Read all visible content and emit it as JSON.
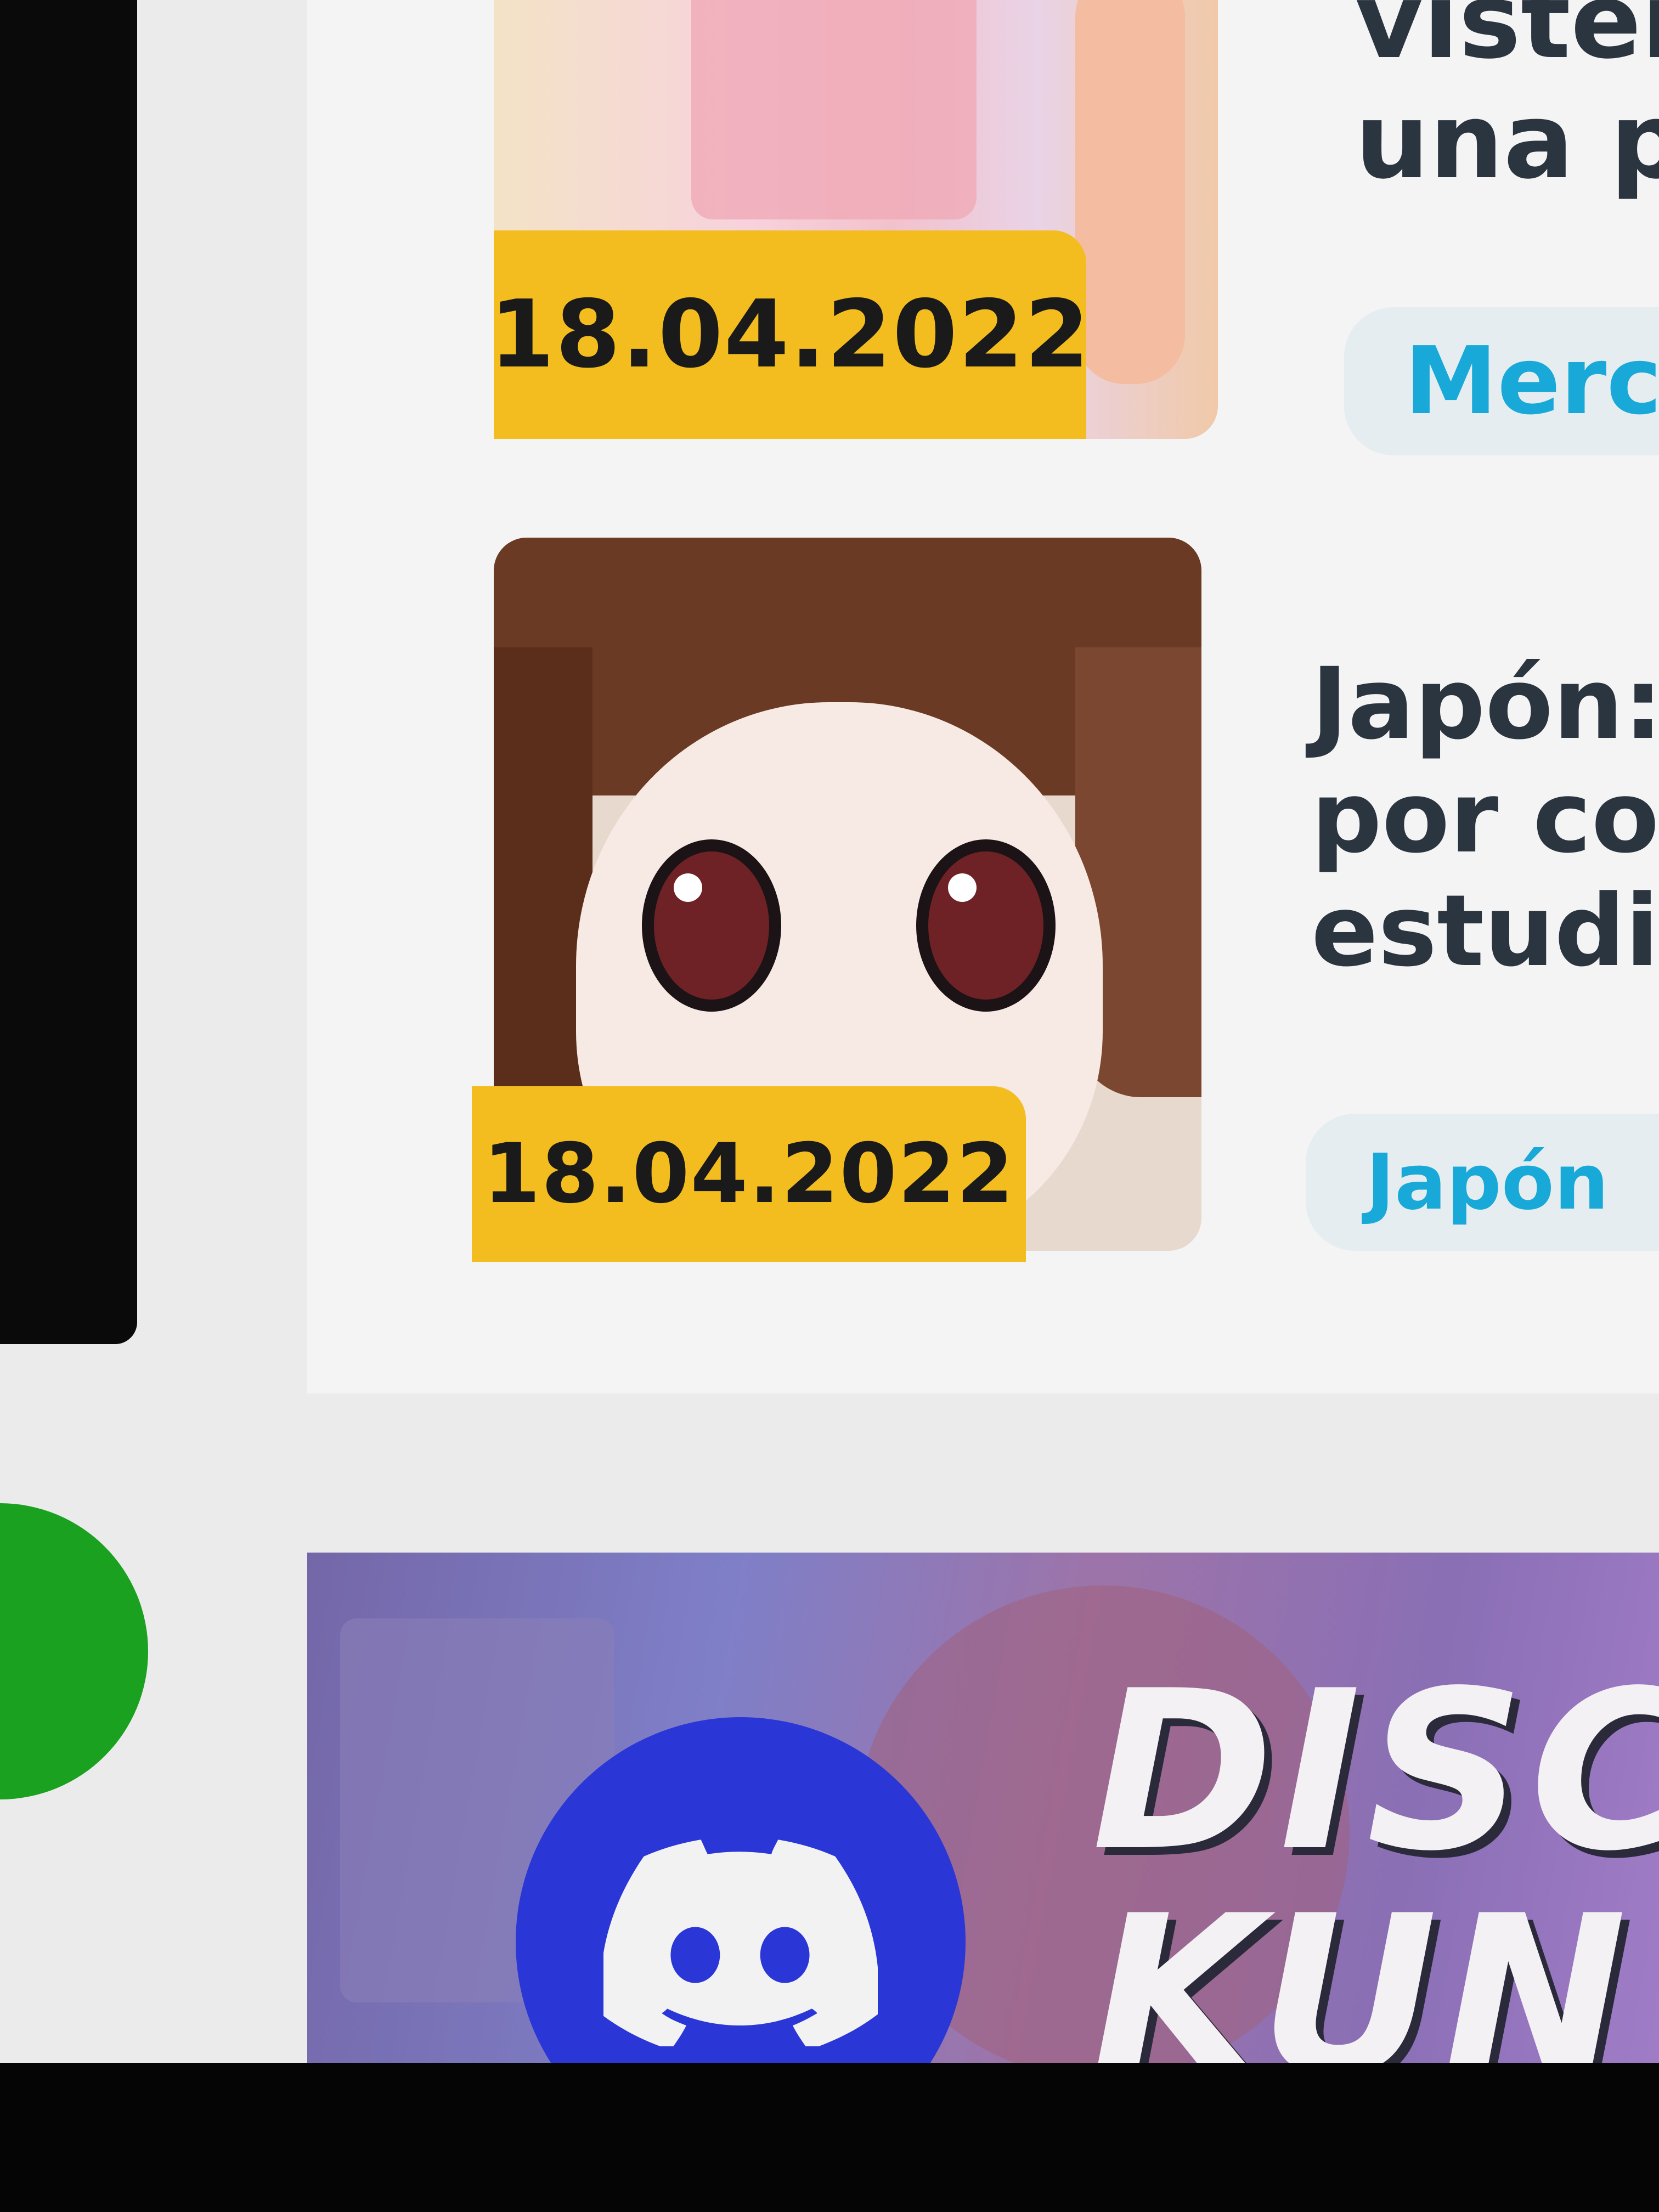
{
  "articles": [
    {
      "date": "18.04.2022",
      "title_lines": [
        "visten",
        "una pr"
      ],
      "category": "Merca"
    },
    {
      "date": "18.04.2022",
      "title_lines": [
        "Japón: A",
        "por cor",
        "estudian"
      ],
      "category": "Japón"
    }
  ],
  "banner": {
    "title": "DISC",
    "subtitle": "KUN",
    "icon": "discord-icon"
  },
  "colors": {
    "date_badge": "#f4bd1f",
    "category_text": "#18a9d8",
    "discord_blue": "#2a36d6",
    "green_button": "#1aa11f"
  }
}
